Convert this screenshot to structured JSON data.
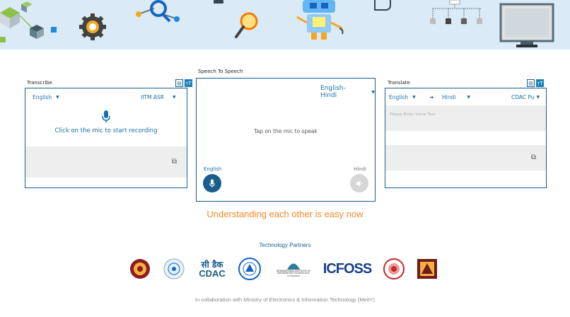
{
  "transcribe": {
    "label": "Transcribe",
    "language": "English",
    "model": "IITM ASR",
    "prompt": "Click on the mic to start recording"
  },
  "speech_to_speech": {
    "label": "Speech To Speech",
    "language_pair": "English-Hindi",
    "prompt": "Tap on the mic to speak",
    "source_language": "English",
    "target_language": "Hindi"
  },
  "translate": {
    "label": "Translate",
    "source_language": "English",
    "arrow": "➔",
    "target_language": "Hindi",
    "model": "CDAC Pu",
    "placeholder": "Please Enter Some Text"
  },
  "icons": {
    "doc": "document-icon",
    "font": "font-size-icon",
    "copy": "copy-icon",
    "mic": "microphone-icon",
    "speaker": "speaker-icon"
  },
  "tagline": "Understanding each other is easy now",
  "partners_title": "Technology Partners",
  "partner_logos": {
    "cdac": "सी डैक",
    "cdac_latin": "CDAC",
    "iiit": "INTERNATIONAL INSTITUTE OF INFORMATION TECHNOLOGY",
    "iiit_city": "HYDERABAD",
    "icfoss": "ICFOSS"
  },
  "footer": "In collaboration with Ministry of Electronics & Information Technology (MeitY)",
  "colors": {
    "primary": "#1a5d8c",
    "accent": "#f08a2a",
    "banner": "#dbeaf7"
  }
}
